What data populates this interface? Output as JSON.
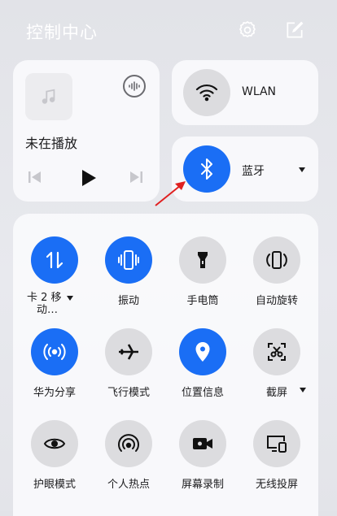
{
  "header": {
    "title": "控制中心",
    "settings_icon": "gear-icon",
    "edit_icon": "edit-icon"
  },
  "media": {
    "status": "未在播放",
    "art_icon": "music-note-icon",
    "audio_icon": "audio-output-icon",
    "prev_icon": "previous-icon",
    "play_icon": "play-icon",
    "next_icon": "next-icon"
  },
  "wlan": {
    "label": "WLAN",
    "icon": "wifi-icon",
    "active": false
  },
  "bluetooth": {
    "label": "蓝牙",
    "icon": "bluetooth-icon",
    "active": true
  },
  "tiles": [
    {
      "label": "卡 2 移",
      "label2": "动…",
      "icon": "data-arrows-icon",
      "active": true,
      "dropdown": true
    },
    {
      "label": "振动",
      "icon": "vibrate-icon",
      "active": true
    },
    {
      "label": "手电筒",
      "icon": "flashlight-icon",
      "active": false
    },
    {
      "label": "自动旋转",
      "icon": "auto-rotate-icon",
      "active": false
    },
    {
      "label": "华为分享",
      "icon": "share-icon",
      "active": true
    },
    {
      "label": "飞行模式",
      "icon": "airplane-icon",
      "active": false
    },
    {
      "label": "位置信息",
      "icon": "location-icon",
      "active": true
    },
    {
      "label": "截屏",
      "icon": "screenshot-icon",
      "active": false,
      "dropdown": true
    },
    {
      "label": "护眼模式",
      "icon": "eye-icon",
      "active": false
    },
    {
      "label": "个人热点",
      "icon": "hotspot-icon",
      "active": false
    },
    {
      "label": "屏幕录制",
      "icon": "screen-record-icon",
      "active": false
    },
    {
      "label": "无线投屏",
      "icon": "cast-icon",
      "active": false
    }
  ],
  "colors": {
    "accent": "#1a6ef5",
    "tile_off": "#dcdcdf",
    "annotation_arrow": "#e02020"
  }
}
